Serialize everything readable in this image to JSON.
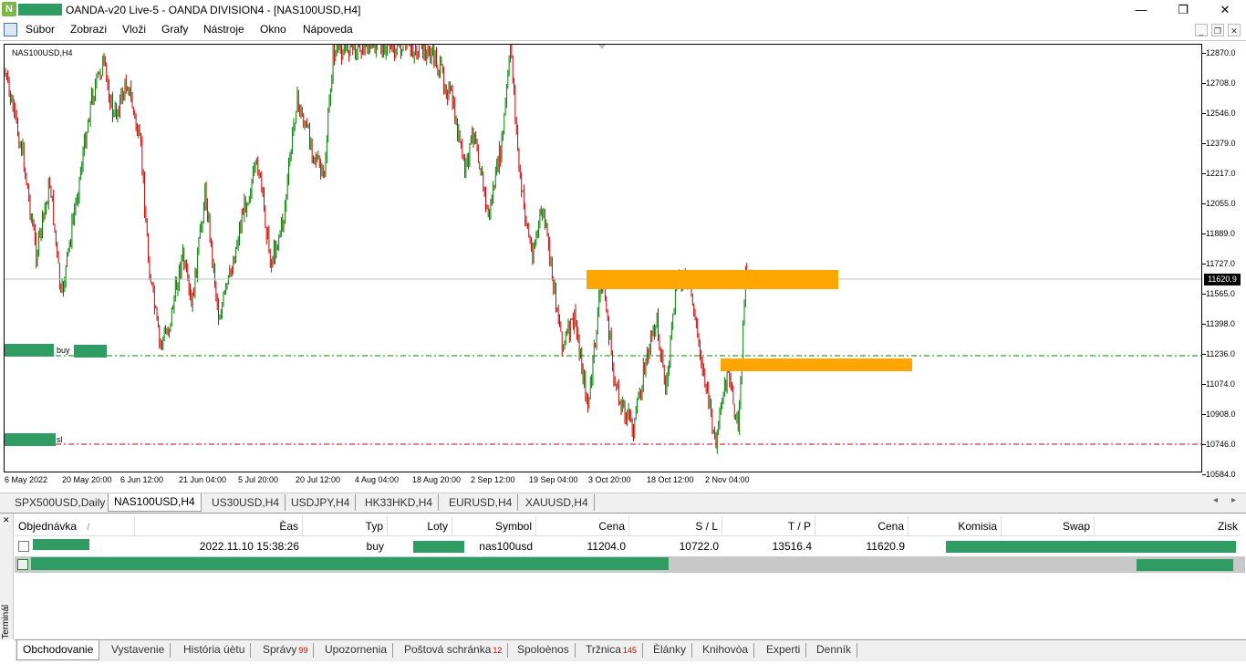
{
  "window": {
    "title": "OANDA-v20 Live-5 - OANDA DIVISION4 - [NAS100USD,H4]",
    "minimize": "—",
    "restore": "❐",
    "close": "✕"
  },
  "menu": [
    "Súbor",
    "Zobrazi",
    "Vloži",
    "Grafy",
    "Nástroje",
    "Okno",
    "Nápoveda"
  ],
  "chart": {
    "label": "NAS100USD,H4",
    "current_price": "11620.9",
    "price_ticks": [
      "12870.0",
      "12708.0",
      "12546.0",
      "12379.0",
      "12217.0",
      "12055.0",
      "11889.0",
      "11727.0",
      "11565.0",
      "11398.0",
      "11236.0",
      "11074.0",
      "10908.0",
      "10746.0",
      "10584.0"
    ],
    "time_ticks": [
      "6 May 2022",
      "20 May 20:00",
      "6 Jun 12:00",
      "21 Jun 04:00",
      "5 Jul 20:00",
      "20 Jul 12:00",
      "4 Aug 04:00",
      "18 Aug 20:00",
      "2 Sep 12:00",
      "19 Sep 04:00",
      "3 Oct 20:00",
      "18 Oct 12:00",
      "2 Nov 04:00"
    ],
    "buy_tag": "buy",
    "sl_tag": "sl",
    "colors": {
      "up": "#008000",
      "down": "#cc0000",
      "zone": "#ffa500",
      "buy_line": "#008000",
      "sl_line": "#cc0000"
    }
  },
  "symbol_tabs": [
    "SPX500USD,Daily",
    "NAS100USD,H4",
    "US30USD,H4",
    "USDJPY,H4",
    "HK33HKD,H4",
    "EURUSD,H4",
    "XAUUSD,H4"
  ],
  "active_symbol_tab": "NAS100USD,H4",
  "terminal": {
    "side_label": "Terminál",
    "close": "✕",
    "columns": [
      "Objednávka",
      "Èas",
      "Typ",
      "Loty",
      "Symbol",
      "Cena",
      "S / L",
      "T / P",
      "Cena",
      "Komisia",
      "Swap",
      "Zisk"
    ],
    "sort_indicator": "/",
    "order": {
      "time": "2022.11.10 15:38:26",
      "type": "buy",
      "symbol": "nas100usd",
      "price": "11204.0",
      "sl": "10722.0",
      "tp": "13516.4",
      "current": "11620.9"
    },
    "tabs": [
      {
        "label": "Obchodovanie",
        "badge": ""
      },
      {
        "label": "Vystavenie",
        "badge": ""
      },
      {
        "label": "História úètu",
        "badge": ""
      },
      {
        "label": "Správy",
        "badge": "99"
      },
      {
        "label": "Upozornenia",
        "badge": ""
      },
      {
        "label": "Poštová schránka",
        "badge": "12"
      },
      {
        "label": "Spoloènos",
        "badge": ""
      },
      {
        "label": "Tržnica",
        "badge": "145"
      },
      {
        "label": "Èlánky",
        "badge": ""
      },
      {
        "label": "Knihovòa",
        "badge": ""
      },
      {
        "label": "Experti",
        "badge": ""
      },
      {
        "label": "Denník",
        "badge": ""
      }
    ]
  }
}
